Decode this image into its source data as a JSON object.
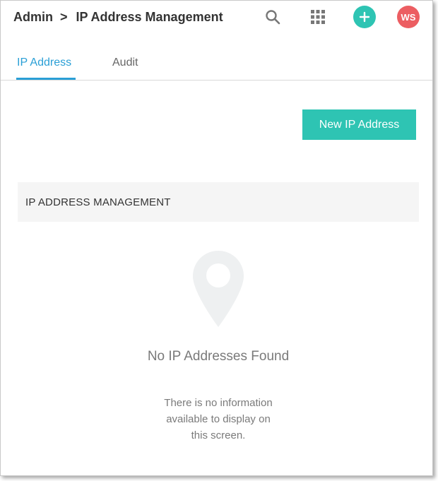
{
  "header": {
    "breadcrumb_root": "Admin",
    "breadcrumb_separator": ">",
    "page_title": "IP Address Management",
    "search_icon": "search-icon",
    "apps_icon": "grid-icon",
    "add_icon": "plus-icon",
    "avatar_initials": "WS",
    "colors": {
      "add_button": "#2ec4b3",
      "avatar": "#ec5e62"
    }
  },
  "tabs": [
    {
      "label": "IP Address",
      "active": true
    },
    {
      "label": "Audit",
      "active": false
    }
  ],
  "toolbar": {
    "new_button_label": "New IP Address"
  },
  "section": {
    "title": "IP ADDRESS MANAGEMENT"
  },
  "empty_state": {
    "icon": "location-pin-icon",
    "title": "No IP Addresses Found",
    "description": "There is no information available to display on this screen."
  },
  "colors": {
    "accent": "#2a9fd6",
    "primary_button": "#2ec4b3",
    "section_background": "#f5f5f5"
  }
}
